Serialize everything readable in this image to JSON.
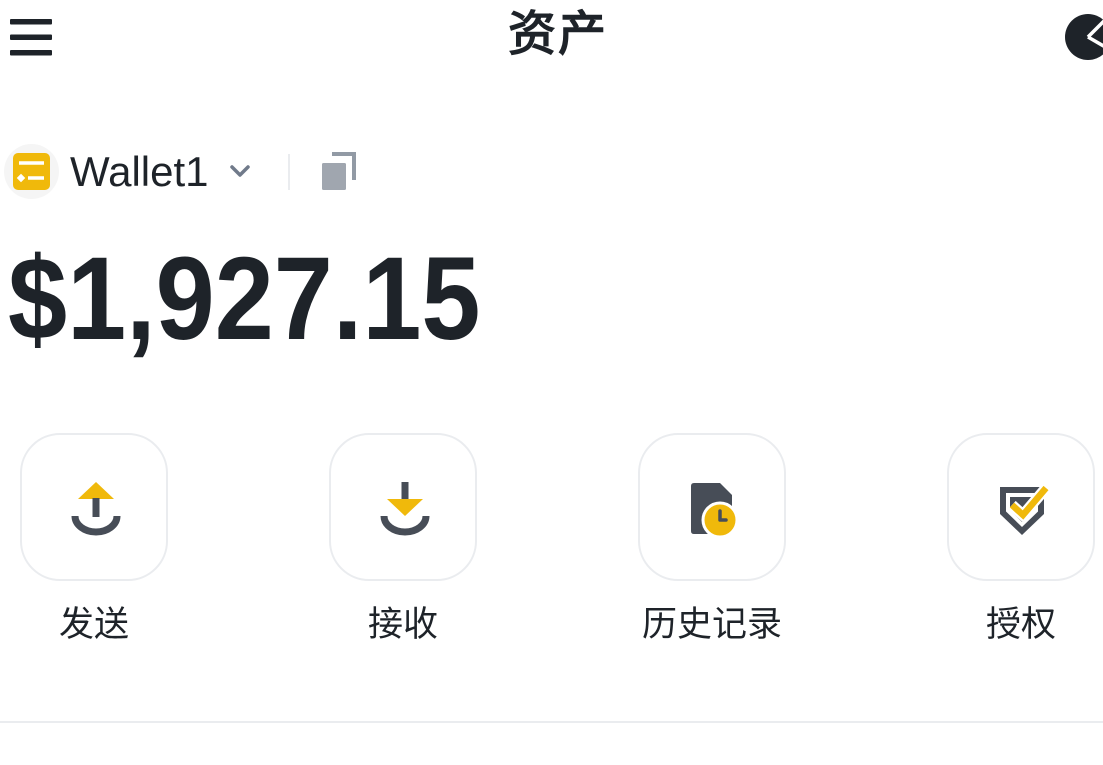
{
  "header": {
    "title": "资产",
    "menu_icon": "hamburger-menu-icon",
    "right_icon": "pie-chart-icon"
  },
  "wallet": {
    "name": "Wallet1",
    "avatar_icon": "wallet-icon",
    "dropdown_icon": "chevron-down-icon",
    "copy_icon": "copy-icon"
  },
  "balance": {
    "amount": "$1,927.15"
  },
  "actions": [
    {
      "label": "发送",
      "icon": "send-icon"
    },
    {
      "label": "接收",
      "icon": "receive-icon"
    },
    {
      "label": "历史记录",
      "icon": "history-icon"
    },
    {
      "label": "授权",
      "icon": "authorize-icon"
    }
  ],
  "colors": {
    "accent": "#F0B90B",
    "text": "#1E2329",
    "icon_dark": "#474D57",
    "muted": "#929AA5",
    "border": "#EAECEF"
  }
}
